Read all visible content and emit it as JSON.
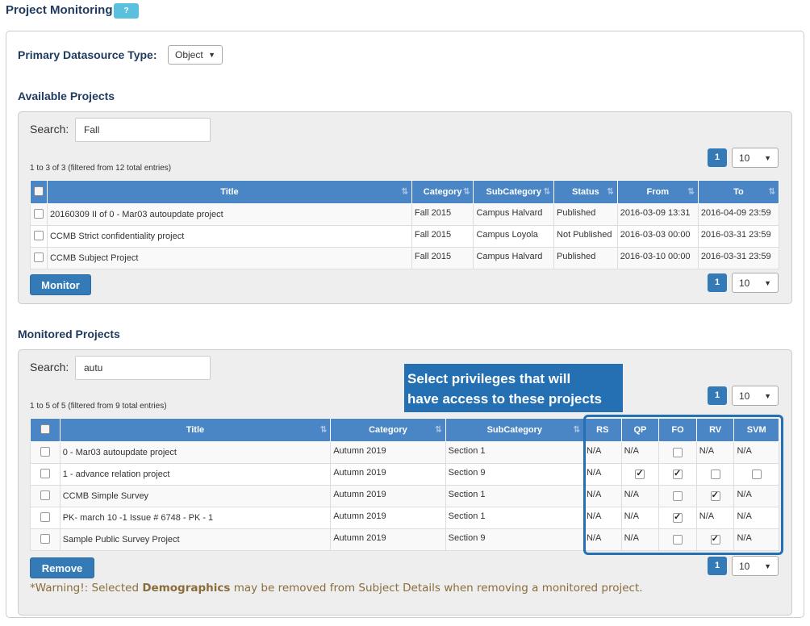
{
  "page": {
    "title": "Project Monitoring",
    "help_label": "?"
  },
  "datasource": {
    "label": "Primary Datasource Type:",
    "selected": "Object"
  },
  "available": {
    "title": "Available Projects",
    "search_label": "Search:",
    "search_value": "Fall",
    "info": "1 to 3 of 3 (filtered from 12 total entries)",
    "page": "1",
    "page_size": "10",
    "columns": [
      "Title",
      "Category",
      "SubCategory",
      "Status",
      "From",
      "To"
    ],
    "rows": [
      {
        "title": "20160309 II of 0 - Mar03 autoupdate project",
        "category": "Fall 2015",
        "subcategory": "Campus Halvard",
        "status": "Published",
        "from": "2016-03-09 13:31",
        "to": "2016-04-09 23:59"
      },
      {
        "title": "CCMB Strict confidentiality project",
        "category": "Fall 2015",
        "subcategory": "Campus Loyola",
        "status": "Not Published",
        "from": "2016-03-03 00:00",
        "to": "2016-03-31 23:59"
      },
      {
        "title": "CCMB Subject Project",
        "category": "Fall 2015",
        "subcategory": "Campus Halvard",
        "status": "Published",
        "from": "2016-03-10 00:00",
        "to": "2016-03-31 23:59"
      }
    ],
    "action_label": "Monitor"
  },
  "monitored": {
    "title": "Monitored Projects",
    "search_label": "Search:",
    "search_value": "autu",
    "info": "1 to 5 of 5 (filtered from 9 total entries)",
    "page": "1",
    "page_size": "10",
    "columns": [
      "Title",
      "Category",
      "SubCategory",
      "RS",
      "QP",
      "FO",
      "RV",
      "SVM"
    ],
    "rows": [
      {
        "title": "0 - Mar03 autoupdate project",
        "category": "Autumn 2019",
        "subcategory": "Section 1",
        "rs": "N/A",
        "qp": "N/A",
        "fo": false,
        "rv": "N/A",
        "svm": "N/A"
      },
      {
        "title": "1 - advance relation project",
        "category": "Autumn 2019",
        "subcategory": "Section 9",
        "rs": "N/A",
        "qp": true,
        "fo": true,
        "rv": false,
        "svm": false
      },
      {
        "title": "CCMB Simple Survey",
        "category": "Autumn 2019",
        "subcategory": "Section 1",
        "rs": "N/A",
        "qp": "N/A",
        "fo": false,
        "rv": true,
        "svm": "N/A"
      },
      {
        "title": "PK- march 10 -1 Issue # 6748 - PK - 1",
        "category": "Autumn 2019",
        "subcategory": "Section 1",
        "rs": "N/A",
        "qp": "N/A",
        "fo": true,
        "rv": "N/A",
        "svm": "N/A"
      },
      {
        "title": "Sample Public Survey Project",
        "category": "Autumn 2019",
        "subcategory": "Section 9",
        "rs": "N/A",
        "qp": "N/A",
        "fo": false,
        "rv": true,
        "svm": "N/A"
      }
    ],
    "action_label": "Remove",
    "callout": [
      "Select privileges that will",
      "have access to these projects"
    ],
    "warning_prefix": "*Warning!: Selected ",
    "warning_bold": "Demographics",
    "warning_suffix": " may be removed from Subject Details when removing a monitored project."
  },
  "colors": {
    "header_blue": "#4a86c5",
    "button_blue": "#337ab7",
    "callout_blue": "#2470b3",
    "help_cyan": "#5bc0de",
    "warning_brown": "#8a6d3b"
  }
}
